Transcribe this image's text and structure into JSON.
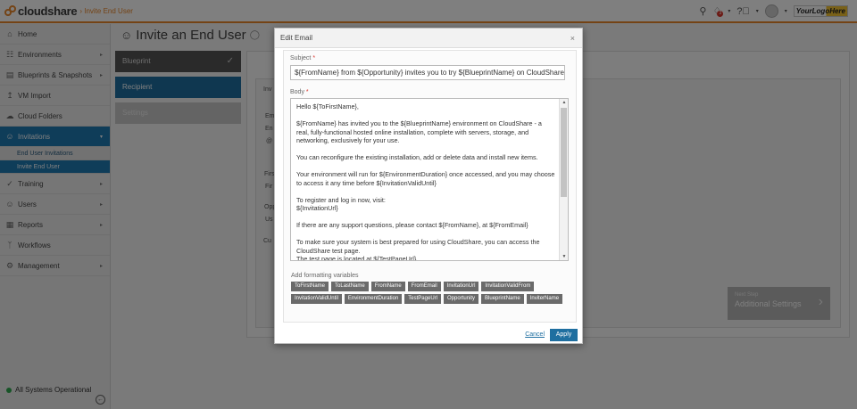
{
  "header": {
    "logo_text": "cloudshare",
    "breadcrumb": "› Invite End User",
    "notification_count": "3",
    "brand_logo_text": "YourLogoHere",
    "accent": "#e8862a"
  },
  "sidebar": {
    "items": [
      {
        "label": "Home",
        "icon": "home-icon"
      },
      {
        "label": "Environments",
        "icon": "environments-icon"
      },
      {
        "label": "Blueprints & Snapshots",
        "icon": "blueprints-icon"
      },
      {
        "label": "VM Import",
        "icon": "upload-icon"
      },
      {
        "label": "Cloud Folders",
        "icon": "cloud-icon"
      },
      {
        "label": "Invitations",
        "icon": "users-icon"
      },
      {
        "label": "Training",
        "icon": "training-icon"
      },
      {
        "label": "Users",
        "icon": "user-icon"
      },
      {
        "label": "Reports",
        "icon": "reports-icon"
      },
      {
        "label": "Workflows",
        "icon": "workflow-icon"
      },
      {
        "label": "Management",
        "icon": "gear-icon"
      }
    ],
    "sub_items": [
      "End User Invitations",
      "Invite End User"
    ],
    "status": "All Systems Operational"
  },
  "page": {
    "title": "Invite an End User",
    "steps": [
      "Blueprint",
      "Recipient",
      "Settings"
    ],
    "next_step_label": "Next Step",
    "next_step_title": "Additional Settings",
    "ghost_labels": [
      "Inv",
      "Em",
      "En",
      "@",
      "Firs",
      "Fir",
      "Opp",
      "Us",
      "Cu"
    ]
  },
  "modal": {
    "title": "Edit Email",
    "subject_label": "Subject",
    "subject_value": "${FromName} from ${Opportunity} invites you to try ${BlueprintName} on CloudShare",
    "body_label": "Body",
    "body_paragraphs": [
      "Hello ${ToFirstName},",
      "${FromName} has invited you to the ${BlueprintName} environment on CloudShare - a real, fully-functional hosted online installation, complete with servers, storage, and networking, exclusively for your use.",
      "You can reconfigure the existing installation, add or delete data and install new items.",
      "Your environment will run for ${EnvironmentDuration} once accessed, and you may choose to access it any time before ${InvitationValidUntil}",
      "To register and log in now, visit:\n${InvitationUrl}",
      "If there are any support questions, please contact ${FromName}, at ${FromEmail}",
      "To make sure your system is best prepared for using CloudShare, you can access the CloudShare test page.\nThe test page is located at ${TestPageUrl}"
    ],
    "vars_label": "Add formatting variables",
    "variables": [
      "ToFirstName",
      "ToLastName",
      "FromName",
      "FromEmail",
      "InvitationUrl",
      "InvitationValidFrom",
      "InvitationValidUntil",
      "EnvironmentDuration",
      "TestPageUrl",
      "Opportunity",
      "BlueprintName",
      "InviterName"
    ],
    "cancel_label": "Cancel",
    "apply_label": "Apply"
  }
}
